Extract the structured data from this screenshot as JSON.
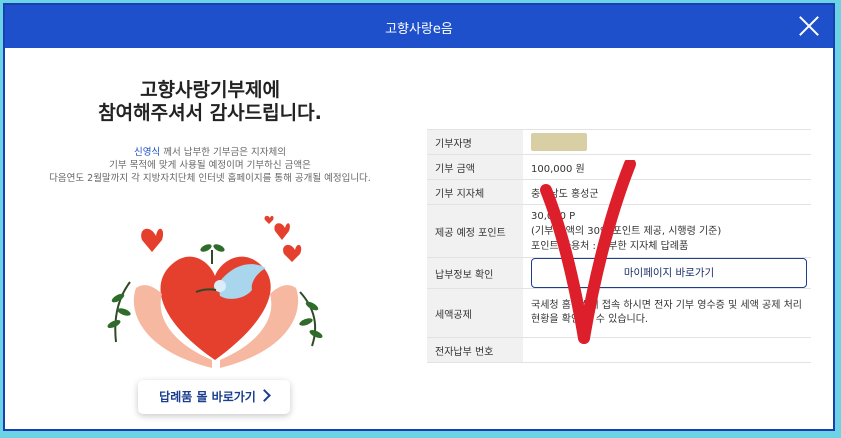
{
  "modal": {
    "title": "고향사랑e음"
  },
  "headline": {
    "line1": "고향사랑기부제에",
    "line2": "참여해주셔서 감사드립니다."
  },
  "description": {
    "donor_name": "신영식",
    "line1_rest": " 께서 납부한 기부금은 지자체의",
    "line2": "기부 목적에 맞게 사용될 예정이며 기부하신 금액은",
    "line3": "다음연도 2월말까지 각 지방자치단체 인터넷 홈페이지를 통해 공개될 예정입니다."
  },
  "gift_mall_button": {
    "label": "답례품 몰 바로가기"
  },
  "table": {
    "donor_label": "기부자명",
    "amount_label": "기부 금액",
    "amount_value": "100,000 원",
    "region_label": "기부 지자체",
    "region_value": "충청남도 홍성군",
    "points_label": "제공 예정 포인트",
    "points_line1": "30,000 P",
    "points_line2": "(기부 금액의 30% 포인트 제공, 시행령 기준)",
    "points_line3": "포인트 사용처 : 기부한 지자체 답례품",
    "payment_label": "납부정보 확인",
    "mypage_button": "마이페이지 바로가기",
    "tax_label": "세액공제",
    "tax_value": "국세청 홈택스에 접속 하시면 전자 기부 영수증 및 세액 공제 처리 현황을 확인 할 수 있습니다.",
    "epay_label": "전자납부 번호",
    "epay_value": ""
  },
  "colors": {
    "accent": "#1e50cc",
    "background": "#6ad3e6",
    "heart": "#e5402e",
    "check": "#dd1f2c"
  }
}
